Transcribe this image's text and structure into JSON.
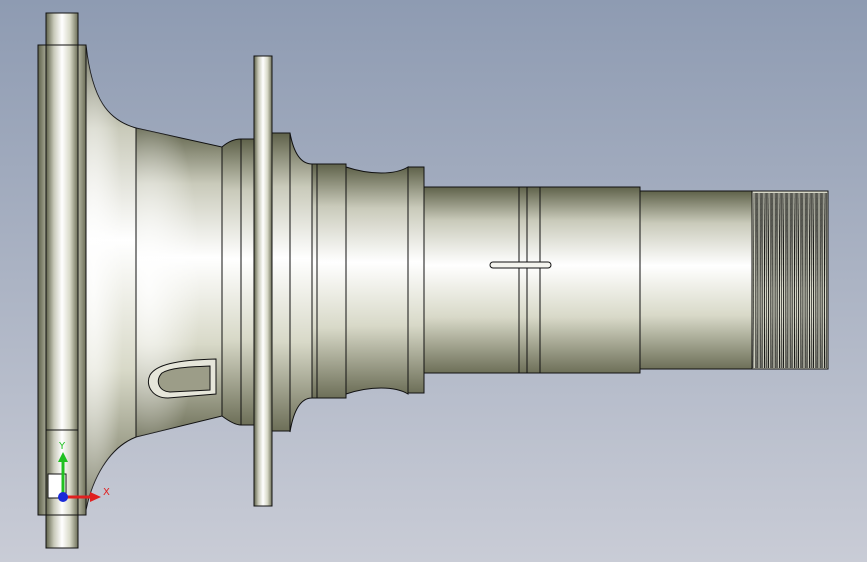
{
  "viewport": {
    "background_top": "#8e9bb2",
    "background_bottom": "#c9ccd6"
  },
  "part": {
    "body_colors": [
      "#5f624a",
      "#c9caba",
      "#ffffff",
      "#d8d9c8",
      "#6d6f58"
    ],
    "edge_color": "#111111",
    "spline_color": "#000000"
  },
  "triad": {
    "x_label": "X",
    "y_label": "Y",
    "x_color": "#e02020",
    "y_color": "#20c020",
    "z_color": "#1a2ad8"
  },
  "icons": [
    "coordinate-triad-icon"
  ]
}
